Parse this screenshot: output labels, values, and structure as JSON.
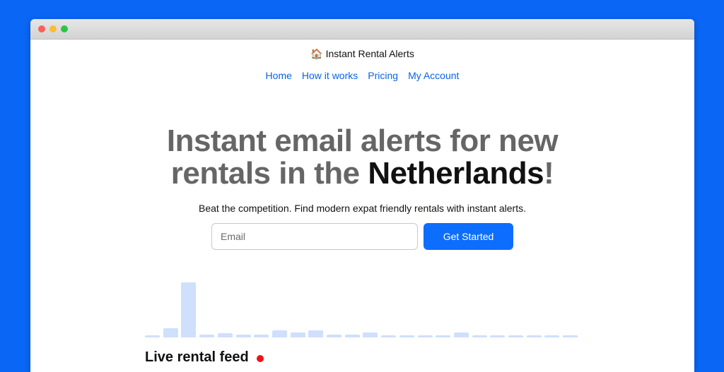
{
  "site": {
    "title": "Instant Rental Alerts",
    "icon": "house-emoji"
  },
  "nav": {
    "items": [
      {
        "label": "Home"
      },
      {
        "label": "How it works"
      },
      {
        "label": "Pricing"
      },
      {
        "label": "My Account"
      }
    ]
  },
  "hero": {
    "line1": "Instant email alerts for new",
    "line2_prefix": "rentals in the ",
    "line2_strong": "Netherlands",
    "line2_suffix": "!"
  },
  "subtitle": "Beat the competition. Find modern expat friendly rentals with instant alerts.",
  "signup": {
    "email_placeholder": "Email",
    "button_label": "Get Started"
  },
  "activity": {
    "levels": [
      0.04,
      0.17,
      1.0,
      0.05,
      0.08,
      0.05,
      0.05,
      0.13,
      0.09,
      0.13,
      0.05,
      0.05,
      0.09,
      0.04,
      0.04,
      0.04,
      0.04,
      0.09,
      0.04,
      0.04,
      0.04,
      0.04,
      0.04,
      0.04
    ]
  },
  "feed": {
    "heading": "Live rental feed",
    "live_color": "#e8151b"
  },
  "colors": {
    "background": "#0a66f5",
    "accent": "#0d6efd",
    "link": "#0b63e5",
    "bar": "#cfe0fc"
  }
}
